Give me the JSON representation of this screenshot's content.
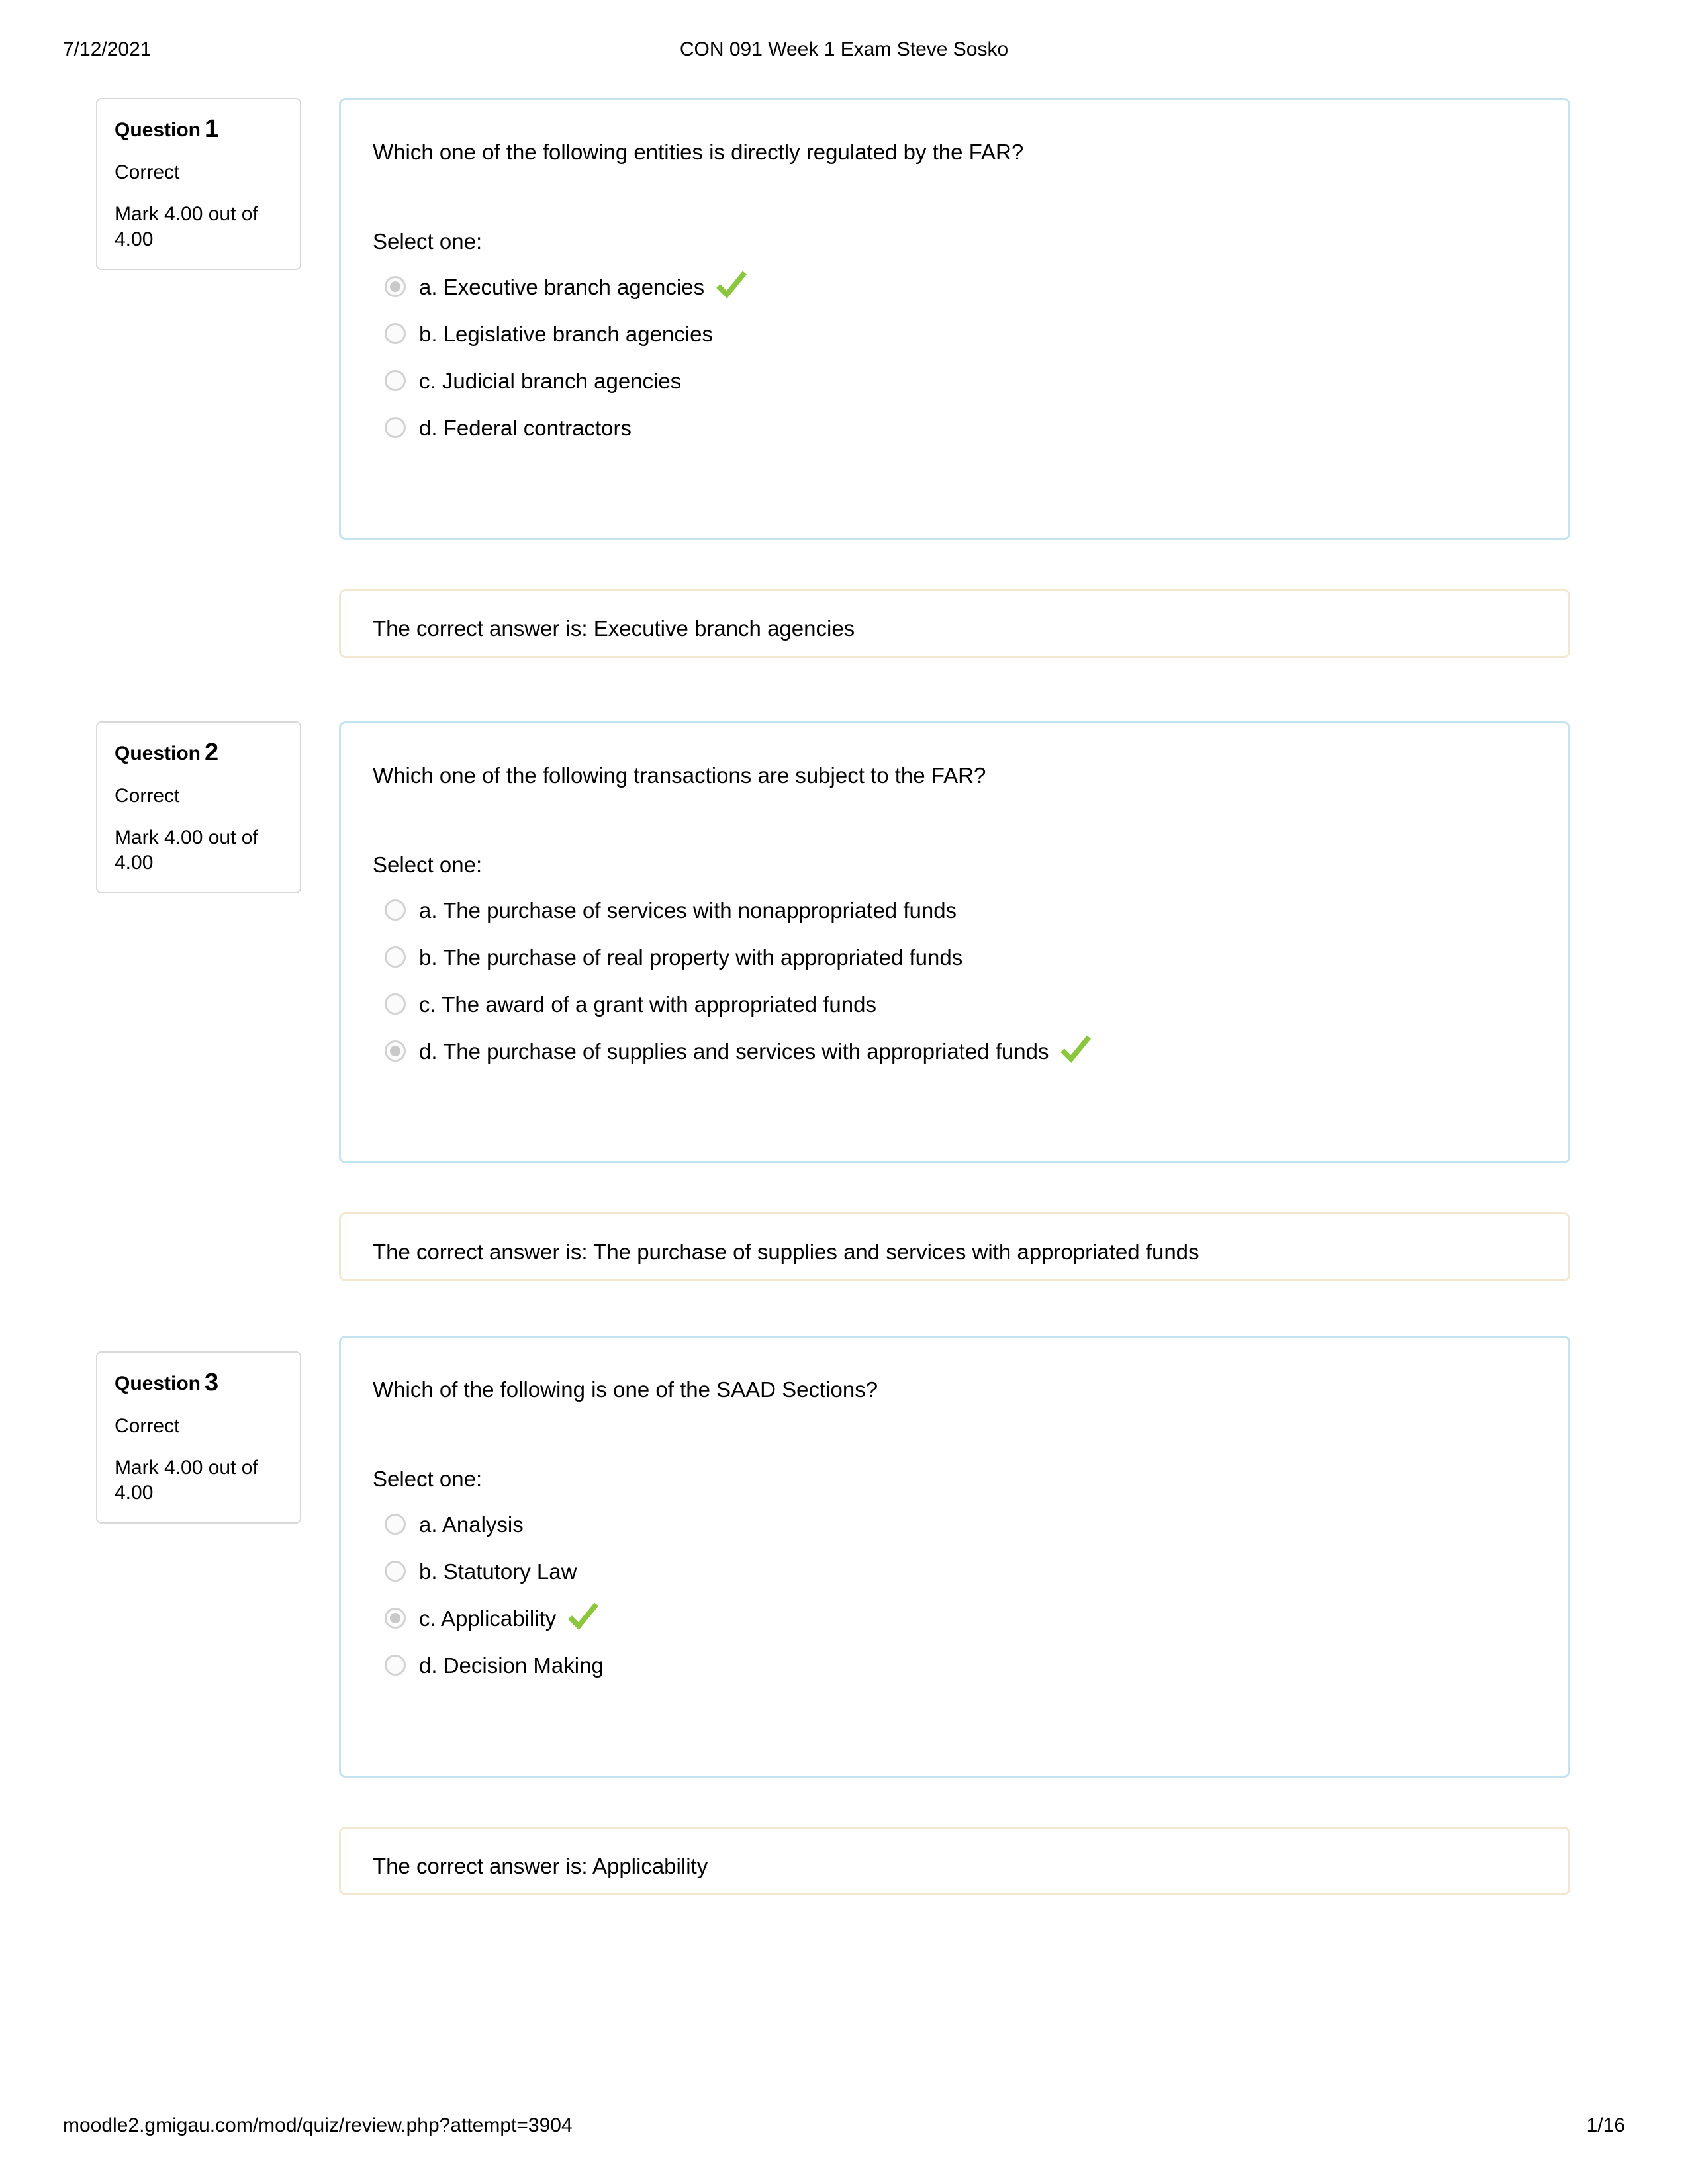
{
  "print_header": {
    "date": "7/12/2021",
    "title": "CON 091 Week 1 Exam Steve Sosko"
  },
  "print_footer": {
    "url": "moodle2.gmigau.com/mod/quiz/review.php?attempt=3904",
    "page": "1/16"
  },
  "colors": {
    "card_border": "#c2e3ef",
    "info_border": "#d9d9d9",
    "feedback_border": "#f4e7d2",
    "check_green": "#8cc63f",
    "radio_border": "#d2d2d2",
    "radio_dot": "#c9c9c9"
  },
  "labels": {
    "question_word": "Question",
    "select_one": "Select one:"
  },
  "questions": [
    {
      "number": "1",
      "state": "Correct",
      "mark": "Mark 4.00 out of 4.00",
      "text": "Which one of the following entities is directly regulated by the FAR?",
      "select_one": "Select one:",
      "options": [
        {
          "label": "a. Executive branch agencies",
          "selected": true,
          "correct_tick": true
        },
        {
          "label": "b. Legislative branch agencies",
          "selected": false,
          "correct_tick": false
        },
        {
          "label": "c. Judicial branch agencies",
          "selected": false,
          "correct_tick": false
        },
        {
          "label": "d. Federal contractors",
          "selected": false,
          "correct_tick": false
        }
      ],
      "feedback": "The correct answer is: Executive branch agencies"
    },
    {
      "number": "2",
      "state": "Correct",
      "mark": "Mark 4.00 out of 4.00",
      "text": "Which one of the following transactions are subject to the FAR?",
      "select_one": "Select one:",
      "options": [
        {
          "label": "a. The purchase of services with nonappropriated funds",
          "selected": false,
          "correct_tick": false
        },
        {
          "label": "b. The purchase of real property with appropriated funds",
          "selected": false,
          "correct_tick": false
        },
        {
          "label": "c. The award of a grant with appropriated funds",
          "selected": false,
          "correct_tick": false
        },
        {
          "label": "d. The purchase of supplies and services with appropriated funds",
          "selected": true,
          "correct_tick": true
        }
      ],
      "feedback": "The correct answer is: The purchase of supplies and services with appropriated funds"
    },
    {
      "number": "3",
      "state": "Correct",
      "mark": "Mark 4.00 out of 4.00",
      "text": "Which of the following is one of the SAAD Sections?",
      "select_one": "Select one:",
      "options": [
        {
          "label": "a. Analysis",
          "selected": false,
          "correct_tick": false
        },
        {
          "label": "b. Statutory Law",
          "selected": false,
          "correct_tick": false
        },
        {
          "label": "c. Applicability",
          "selected": true,
          "correct_tick": true
        },
        {
          "label": "d. Decision Making",
          "selected": false,
          "correct_tick": false
        }
      ],
      "feedback": "The correct answer is: Applicability"
    }
  ]
}
